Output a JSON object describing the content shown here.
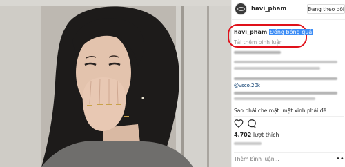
{
  "header": {
    "username": "havi_pham",
    "follow_label": "Đang theo dõi"
  },
  "caption": {
    "username": "havi_pham",
    "text": "Đồng bóng quá"
  },
  "load_more": "Tải thêm bình luận",
  "comments": {
    "mention_1": "@vsco.20k",
    "visible_comment": "Sao phải che mặt. mặt xinh phải để"
  },
  "likes": {
    "count": "4,702",
    "label": "lượt thích"
  },
  "add_comment": {
    "placeholder": "Thêm bình luận..."
  },
  "more_symbol": "•••",
  "icons": [
    "heart-icon",
    "comment-icon",
    "more-options-icon"
  ],
  "colors": {
    "highlight": "#3d8df5",
    "annotation": "#e0111a",
    "link": "#003569"
  }
}
